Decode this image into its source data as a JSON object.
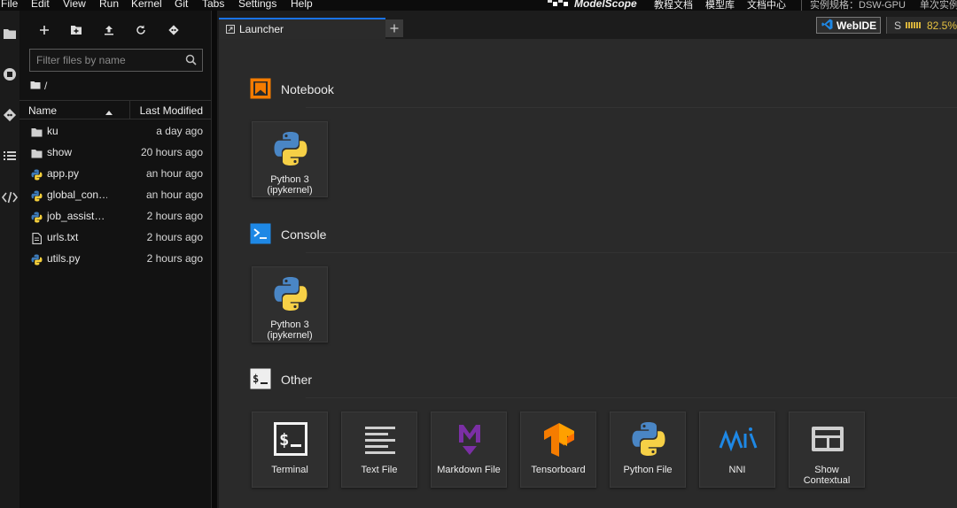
{
  "menubar": {
    "items": [
      "File",
      "Edit",
      "View",
      "Run",
      "Kernel",
      "Git",
      "Tabs",
      "Settings",
      "Help"
    ],
    "brand": "ModelScope",
    "links": [
      "教程文档",
      "模型库",
      "文档中心"
    ],
    "instance_spec": "实例规格：DSW-GPU",
    "instance_extra": "单次实例"
  },
  "sidebar": {
    "filter_placeholder": "Filter files by name",
    "breadcrumb": "/",
    "columns": {
      "name": "Name",
      "modified": "Last Modified"
    },
    "files": [
      {
        "name": "ku",
        "modified": "a day ago",
        "icon": "folder-icon"
      },
      {
        "name": "show",
        "modified": "20 hours ago",
        "icon": "folder-icon"
      },
      {
        "name": "app.py",
        "modified": "an hour ago",
        "icon": "python-file-icon"
      },
      {
        "name": "global_con…",
        "modified": "an hour ago",
        "icon": "python-file-icon"
      },
      {
        "name": "job_assist…",
        "modified": "2 hours ago",
        "icon": "python-file-icon"
      },
      {
        "name": "urls.txt",
        "modified": "2 hours ago",
        "icon": "text-file-icon"
      },
      {
        "name": "utils.py",
        "modified": "2 hours ago",
        "icon": "python-file-icon"
      }
    ]
  },
  "tabs": [
    {
      "label": "Launcher"
    }
  ],
  "toolbar": {
    "webide_label": "WebIDE",
    "status_label": "S",
    "status_percent": "82.5%"
  },
  "launcher": {
    "sections": [
      {
        "title": "Notebook",
        "cards": [
          {
            "label1": "Python 3",
            "label2": "(ipykernel)"
          }
        ]
      },
      {
        "title": "Console",
        "cards": [
          {
            "label1": "Python 3",
            "label2": "(ipykernel)"
          }
        ]
      },
      {
        "title": "Other",
        "cards": [
          {
            "label1": "Terminal",
            "label2": ""
          },
          {
            "label1": "Text File",
            "label2": ""
          },
          {
            "label1": "Markdown File",
            "label2": ""
          },
          {
            "label1": "Tensorboard",
            "label2": ""
          },
          {
            "label1": "Python File",
            "label2": ""
          },
          {
            "label1": "NNI",
            "label2": ""
          },
          {
            "label1": "Show",
            "label2": "Contextual"
          }
        ]
      }
    ]
  },
  "colors": {
    "accent": "#1a73e8",
    "notebook_orange": "#f57c00",
    "console_blue": "#1e88e5",
    "markdown_purple": "#7b2fa5"
  }
}
